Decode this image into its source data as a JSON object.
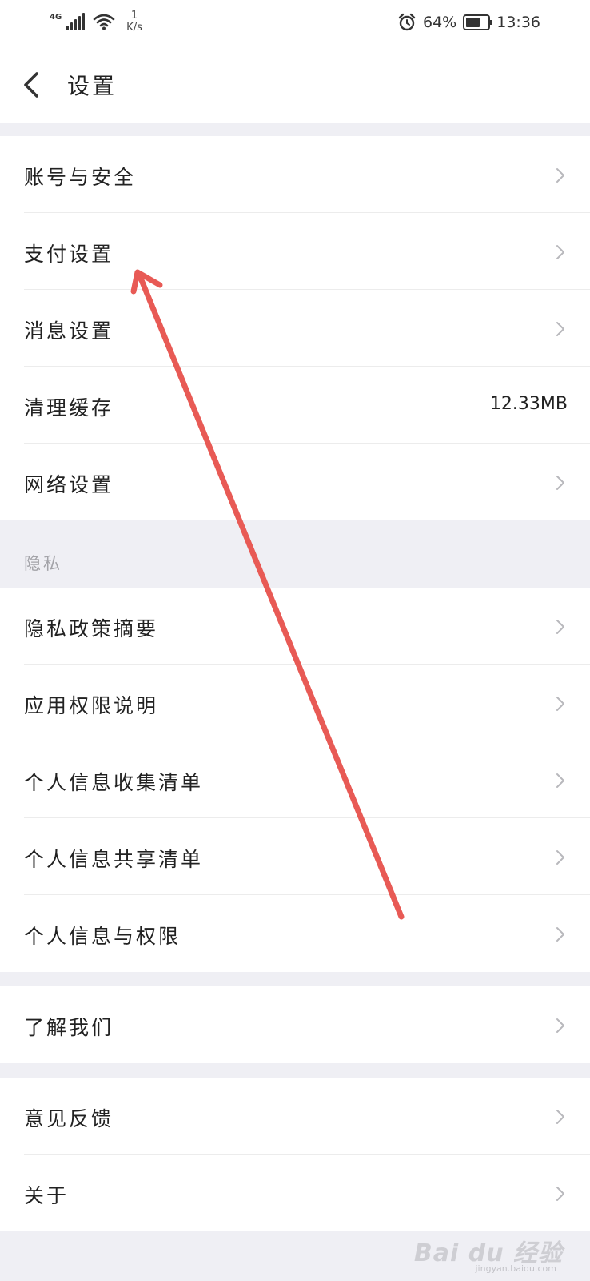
{
  "status_bar": {
    "network": "4G",
    "speed_value": "1",
    "speed_unit": "K/s",
    "battery_text": "64%",
    "battery_level": 0.64,
    "time": "13:36"
  },
  "header": {
    "title": "设置"
  },
  "groups": {
    "general": {
      "items": [
        {
          "label": "账号与安全"
        },
        {
          "label": "支付设置"
        },
        {
          "label": "消息设置"
        },
        {
          "label": "清理缓存",
          "value": "12.33MB"
        },
        {
          "label": "网络设置"
        }
      ]
    },
    "privacy": {
      "title": "隐私",
      "items": [
        {
          "label": "隐私政策摘要"
        },
        {
          "label": "应用权限说明"
        },
        {
          "label": "个人信息收集清单"
        },
        {
          "label": "个人信息共享清单"
        },
        {
          "label": "个人信息与权限"
        }
      ]
    },
    "about_us": {
      "items": [
        {
          "label": "了解我们"
        }
      ]
    },
    "feedback": {
      "items": [
        {
          "label": "意见反馈"
        },
        {
          "label": "关于"
        }
      ]
    }
  },
  "watermark": {
    "text": "Bai du 经验",
    "sub": "jingyan.baidu.com"
  },
  "colors": {
    "annotation_arrow": "#e85a55",
    "section_background": "#efeff4",
    "divider": "#ececec",
    "section_title": "#a3a3a8"
  }
}
